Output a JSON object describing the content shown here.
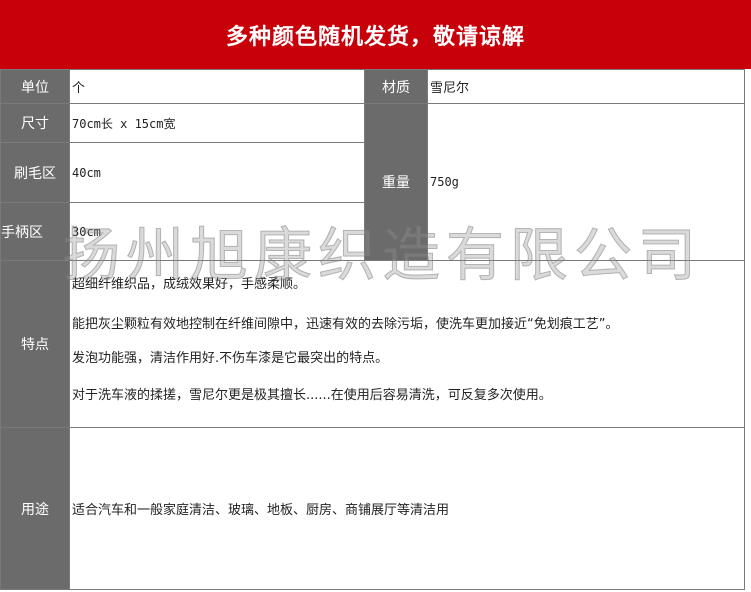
{
  "banner": {
    "title": "多种颜色随机发货，敬请谅解"
  },
  "specs": {
    "unit_label": "单位",
    "unit_value": "个",
    "material_label": "材质",
    "material_value": "雪尼尔",
    "size_label": "尺寸",
    "size_value": "70cm长 x 15cm宽",
    "brush_label": "刷毛区",
    "brush_value": "40cm",
    "weight_label": "重量",
    "weight_value": "750g",
    "handle_label": "手柄区",
    "handle_value": "30cm"
  },
  "features": {
    "label": "特点",
    "lines": [
      "超细纤维织品，成绒效果好，手感柔顺。",
      "能把灰尘颗粒有效地控制在纤维间隙中，迅速有效的去除污垢，使洗车更加接近“免划痕工艺”。",
      "发泡功能强，清洁作用好.不伤车漆是它最突出的特点。",
      "对于洗车液的揉搓，雪尼尔更是极其擅长......在使用后容易清洗，可反复多次使用。"
    ]
  },
  "usage": {
    "label": "用途",
    "value": "适合汽车和一般家庭清洁、玻璃、地板、厨房、商铺展厅等清洁用"
  },
  "watermark": "扬州旭康织造有限公司",
  "colors": {
    "banner": "#c8000a",
    "header_cell": "#6b6b6b"
  }
}
